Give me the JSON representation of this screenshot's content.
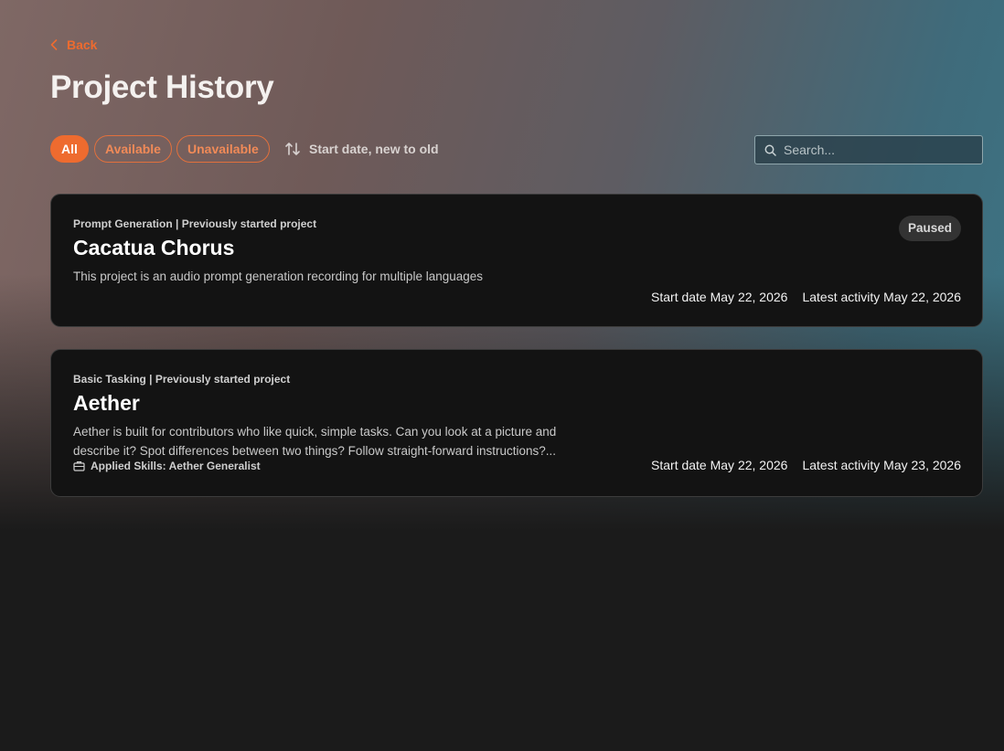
{
  "back": {
    "label": "Back"
  },
  "page_title": "Project History",
  "filters": [
    {
      "label": "All",
      "active": true
    },
    {
      "label": "Available",
      "active": false
    },
    {
      "label": "Unavailable",
      "active": false
    }
  ],
  "sort": {
    "label": "Start date, new to old",
    "icon": "sort-arrows-icon"
  },
  "search": {
    "placeholder": "Search...",
    "value": "",
    "icon": "search-icon"
  },
  "projects": [
    {
      "meta": "Prompt Generation | Previously started project",
      "name": "Cacatua Chorus",
      "description": "This project is an audio prompt generation recording for multiple languages",
      "status": "Paused",
      "start_date": "Start date May 22, 2026",
      "latest_activity": "Latest activity May 22, 2026"
    },
    {
      "meta": "Basic Tasking | Previously started project",
      "name": "Aether",
      "description": "Aether is built for contributors who like quick, simple tasks. Can you look at a picture and describe it? Spot differences between two things? Follow straight-forward instructions?...",
      "skills": "Applied Skills: Aether Generalist",
      "skills_icon": "briefcase-icon",
      "start_date": "Start date May 22, 2026",
      "latest_activity": "Latest activity May 23, 2026"
    }
  ],
  "colors": {
    "accent": "#ee6b2f",
    "card_background": "#131313",
    "page_background": "#1b1b1b"
  }
}
